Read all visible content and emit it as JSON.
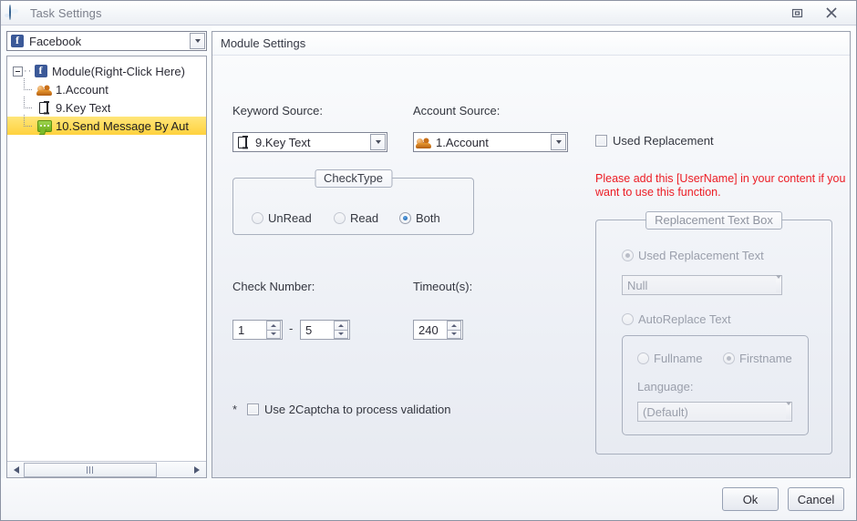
{
  "window": {
    "title": "Task Settings",
    "icon": "globe-icon",
    "maximize_icon": "restore-icon",
    "close_icon": "close-icon"
  },
  "sidebar": {
    "platform_combo": {
      "value": "Facebook",
      "icon": "facebook-icon",
      "arrow": "chevron-down-icon"
    },
    "tree": [
      {
        "label": "Module(Right-Click Here)",
        "icon": "facebook-icon",
        "level": 0,
        "expanded": true,
        "selected": false
      },
      {
        "label": "1.Account",
        "icon": "people-icon",
        "level": 1,
        "selected": false
      },
      {
        "label": "9.Key Text",
        "icon": "keytext-icon",
        "level": 1,
        "selected": false
      },
      {
        "label": "10.Send Message By Aut",
        "icon": "message-icon",
        "level": 1,
        "selected": true
      }
    ],
    "scrollbar": {
      "left_arrow": "triangle-left-icon",
      "right_arrow": "triangle-right-icon",
      "grip": "grip-icon"
    }
  },
  "main": {
    "header": "Module Settings",
    "keyword_source": {
      "label": "Keyword Source:",
      "value": "9.Key Text",
      "icon": "keytext-icon"
    },
    "account_source": {
      "label": "Account Source:",
      "value": "1.Account",
      "icon": "people-icon"
    },
    "check_type": {
      "title": "CheckType",
      "options": [
        {
          "label": "UnRead",
          "selected": false
        },
        {
          "label": "Read",
          "selected": false
        },
        {
          "label": "Both",
          "selected": true
        }
      ]
    },
    "check_number": {
      "label": "Check Number:",
      "min": "1",
      "separator": "-",
      "max": "5"
    },
    "timeout": {
      "label": "Timeout(s):",
      "value": "240"
    },
    "captcha": {
      "marker": "*",
      "label": "Use 2Captcha to process validation",
      "checked": false
    },
    "used_replacement": {
      "label": "Used  Replacement",
      "checked": false
    },
    "warning": "Please add this [UserName] in your content if you want to use this function.",
    "replacement_box": {
      "title": "Replacement Text Box",
      "used_replacement_text": {
        "label": "Used Replacement Text",
        "selected": true
      },
      "replacement_combo": {
        "value": "Null"
      },
      "auto_replace_text": {
        "label": "AutoReplace Text",
        "selected": false
      },
      "name_options": [
        {
          "label": "Fullname",
          "selected": false
        },
        {
          "label": "Firstname",
          "selected": true
        }
      ],
      "language_label": "Language:",
      "language_combo": {
        "value": "(Default)"
      }
    }
  },
  "footer": {
    "ok_label": "Ok",
    "cancel_label": "Cancel"
  },
  "colors": {
    "warning_red": "#ec1c24",
    "selection_yellow": "#ffd23e",
    "facebook_blue": "#3b5998",
    "radio_blue": "#14559e"
  }
}
